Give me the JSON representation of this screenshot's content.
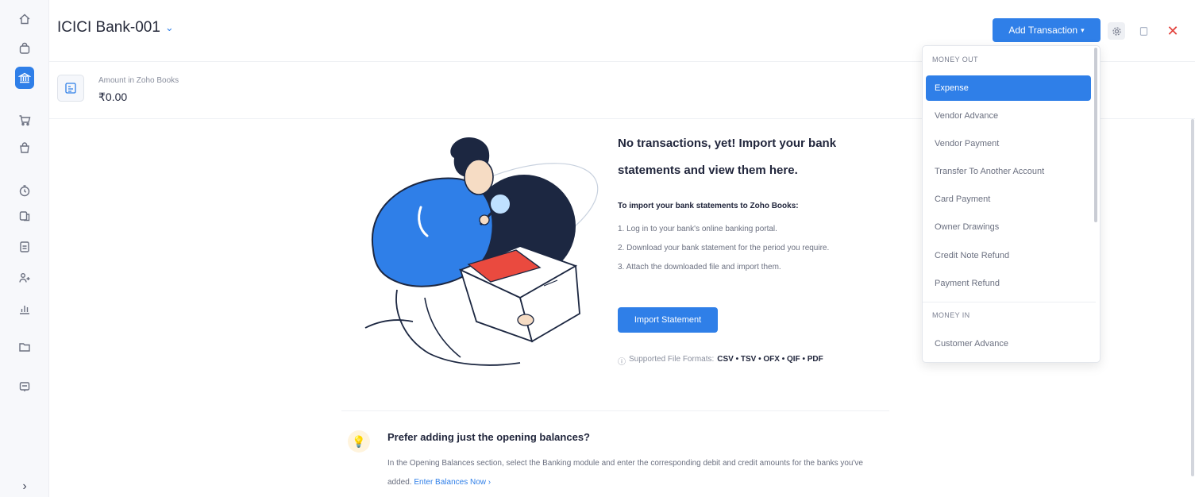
{
  "sidebar": {
    "icons": [
      "home-icon",
      "bag-icon",
      "bank-icon",
      "cart-icon",
      "shopping-bag-icon",
      "clock-icon",
      "files-icon",
      "document-icon",
      "users-icon",
      "chart-icon",
      "folder-icon",
      "documents-icon"
    ],
    "active": "bank-icon",
    "expand_label": "›"
  },
  "header": {
    "account_title": "ICICI Bank-001",
    "add_transaction_label": "Add Transaction",
    "close_label": "✕"
  },
  "balance": {
    "label": "Amount in Zoho Books",
    "value": "₹0.00"
  },
  "empty_state": {
    "title": "No transactions, yet! Import your bank statements and view them here.",
    "steps_heading": "To import your bank statements to Zoho Books:",
    "steps": [
      "1. Log in to your bank's online banking portal.",
      "2. Download your bank statement for the period you require.",
      "3. Attach the downloaded file and import them."
    ],
    "import_button": "Import Statement",
    "formats_label": "Supported File Formats:",
    "formats_value": "CSV • TSV • OFX • QIF • PDF"
  },
  "opening_balances": {
    "title": "Prefer adding just the opening balances?",
    "text": "In the Opening Balances section, select the Banking module and enter the corresponding debit and credit amounts for the banks you've added.",
    "link": "Enter Balances Now ›"
  },
  "menu": {
    "money_out_heading": "MONEY OUT",
    "money_out_items": [
      "Expense",
      "Vendor Advance",
      "Vendor Payment",
      "Transfer To Another Account",
      "Card Payment",
      "Owner Drawings",
      "Credit Note Refund",
      "Payment Refund"
    ],
    "money_in_heading": "MONEY IN",
    "money_in_items": [
      "Customer Advance"
    ],
    "highlighted": "Expense"
  },
  "colors": {
    "accent": "#2f7fe8",
    "close": "#e2403a"
  }
}
